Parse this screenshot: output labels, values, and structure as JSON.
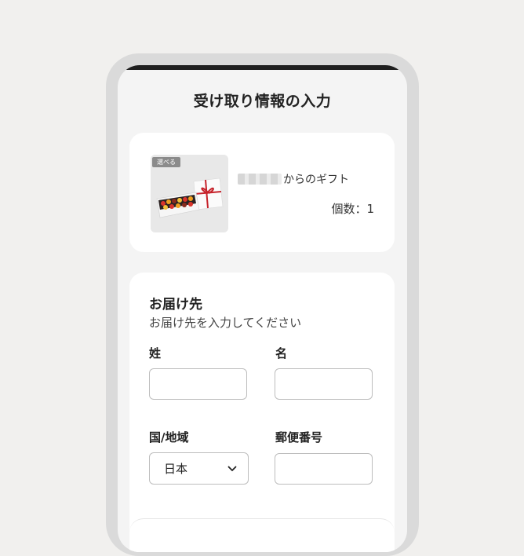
{
  "header": {
    "title": "受け取り情報の入力"
  },
  "gift": {
    "tag": "選べる",
    "from_suffix": "からのギフト",
    "quantity": "個数：1"
  },
  "delivery": {
    "title": "お届け先",
    "subtitle": "お届け先を入力してください",
    "last_name_label": "姓",
    "first_name_label": "名",
    "country_label": "国/地域",
    "country_value": "日本",
    "postal_label": "郵便番号"
  },
  "colors": {
    "background": "#f1f0ee",
    "phone_frame": "#dadada",
    "card": "#ffffff",
    "input_border": "#bdbdbd",
    "ribbon": "#c6232b"
  },
  "icons": {
    "select": "chevron-down-icon",
    "product": "gift-box-image"
  }
}
